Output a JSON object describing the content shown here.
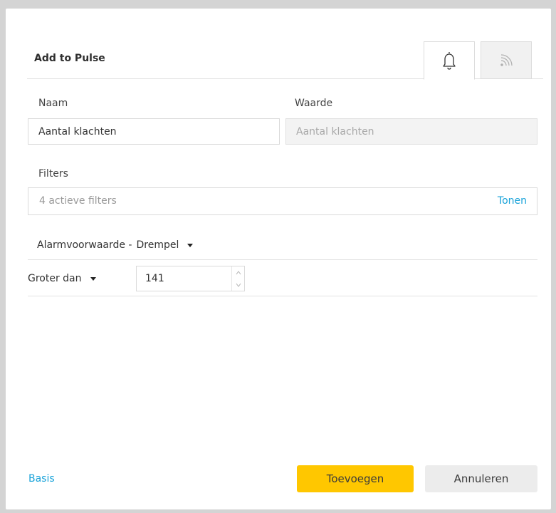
{
  "dialog": {
    "title": "Add to Pulse",
    "tabs": [
      {
        "icon": "bell-icon",
        "active": true
      },
      {
        "icon": "rss-feed-icon",
        "active": false
      }
    ]
  },
  "form": {
    "name_label": "Naam",
    "name_value": "Aantal klachten",
    "value_label": "Waarde",
    "value_placeholder": "Aantal klachten",
    "filters_label": "Filters",
    "filters_summary": "4 actieve filters",
    "filters_show_link": "Tonen",
    "alarm_label": "Alarmvoorwaarde -",
    "alarm_type": "Drempel",
    "condition_operator": "Groter dan",
    "threshold_value": "141"
  },
  "footer": {
    "basis_link": "Basis",
    "add_button": "Toevoegen",
    "cancel_button": "Annuleren"
  },
  "colors": {
    "primary": "#ffc700",
    "link": "#1aa3d9",
    "background": "#d4d4d4"
  }
}
